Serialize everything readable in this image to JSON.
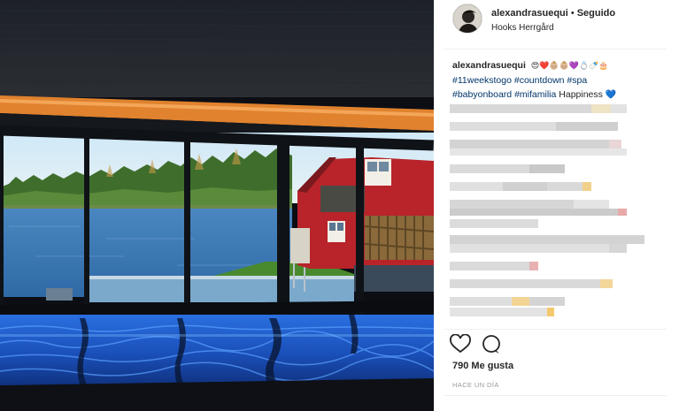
{
  "post": {
    "username": "alexandrasuequi",
    "separator": "•",
    "follow_status": "Seguido",
    "location": "Hooks Herrgård",
    "caption": {
      "username": "alexandrasuequi",
      "emojis": "😍❤️👶🏼👶🏼💜💍🍼🎂",
      "tags": [
        "#11weekstogo",
        "#countdown",
        "#spa",
        "#babyonboard",
        "#mifamilia"
      ],
      "text": "Happiness",
      "end_emoji": "💙"
    },
    "likes": "790 Me gusta",
    "time": "HACE UN DÍA"
  },
  "icons": {
    "like": "heart-outline-icon",
    "comment": "comment-bubble-icon"
  },
  "colors": {
    "hashtag": "#003569",
    "pool_water": "#1e5fd6",
    "barn_red": "#b8242a",
    "grey_text": "#999999"
  }
}
